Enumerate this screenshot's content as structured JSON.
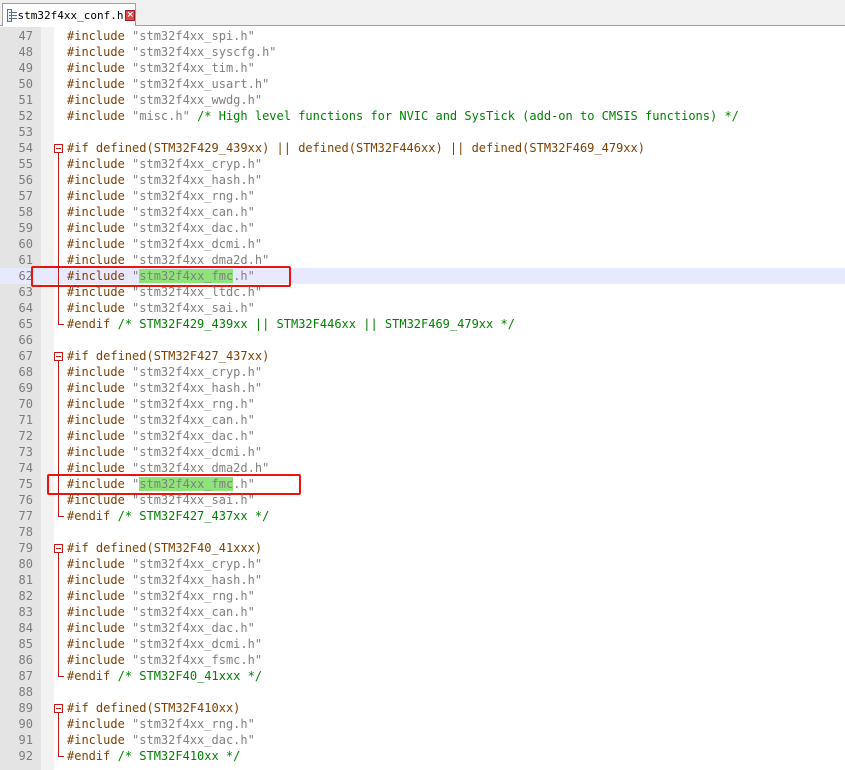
{
  "tab": {
    "label": "stm32f4xx_conf.h",
    "icon": "document-icon",
    "close_icon": "close-icon"
  },
  "colors": {
    "preprocessor": "#804000",
    "string": "#808080",
    "comment": "#008000",
    "find_highlight": "#8fe37a",
    "annotation": "#e8140e",
    "fold_marker": "#c01818",
    "current_line": "#e8e8ff"
  },
  "current_line": 62,
  "lines": [
    {
      "n": "47",
      "segments": [
        {
          "t": "#include ",
          "c": "pp"
        },
        {
          "t": "\"stm32f4xx_spi.h\"",
          "c": "str"
        }
      ]
    },
    {
      "n": "48",
      "segments": [
        {
          "t": "#include ",
          "c": "pp"
        },
        {
          "t": "\"stm32f4xx_syscfg.h\"",
          "c": "str"
        }
      ]
    },
    {
      "n": "49",
      "segments": [
        {
          "t": "#include ",
          "c": "pp"
        },
        {
          "t": "\"stm32f4xx_tim.h\"",
          "c": "str"
        }
      ]
    },
    {
      "n": "50",
      "segments": [
        {
          "t": "#include ",
          "c": "pp"
        },
        {
          "t": "\"stm32f4xx_usart.h\"",
          "c": "str"
        }
      ]
    },
    {
      "n": "51",
      "segments": [
        {
          "t": "#include ",
          "c": "pp"
        },
        {
          "t": "\"stm32f4xx_wwdg.h\"",
          "c": "str"
        }
      ]
    },
    {
      "n": "52",
      "segments": [
        {
          "t": "#include ",
          "c": "pp"
        },
        {
          "t": "\"misc.h\" ",
          "c": "str"
        },
        {
          "t": "/* High level functions for NVIC and SysTick (add-on to CMSIS functions) */",
          "c": "cmt"
        }
      ]
    },
    {
      "n": "53",
      "segments": []
    },
    {
      "n": "54",
      "fold": "open",
      "segments": [
        {
          "t": "#if defined(STM32F429_439xx) || defined(STM32F446xx) || defined(STM32F469_479xx)",
          "c": "pp"
        }
      ]
    },
    {
      "n": "55",
      "segments": [
        {
          "t": "#include ",
          "c": "pp"
        },
        {
          "t": "\"stm32f4xx_cryp.h\"",
          "c": "str"
        }
      ]
    },
    {
      "n": "56",
      "segments": [
        {
          "t": "#include ",
          "c": "pp"
        },
        {
          "t": "\"stm32f4xx_hash.h\"",
          "c": "str"
        }
      ]
    },
    {
      "n": "57",
      "segments": [
        {
          "t": "#include ",
          "c": "pp"
        },
        {
          "t": "\"stm32f4xx_rng.h\"",
          "c": "str"
        }
      ]
    },
    {
      "n": "58",
      "segments": [
        {
          "t": "#include ",
          "c": "pp"
        },
        {
          "t": "\"stm32f4xx_can.h\"",
          "c": "str"
        }
      ]
    },
    {
      "n": "59",
      "segments": [
        {
          "t": "#include ",
          "c": "pp"
        },
        {
          "t": "\"stm32f4xx_dac.h\"",
          "c": "str"
        }
      ]
    },
    {
      "n": "60",
      "segments": [
        {
          "t": "#include ",
          "c": "pp"
        },
        {
          "t": "\"stm32f4xx_dcmi.h\"",
          "c": "str"
        }
      ]
    },
    {
      "n": "61",
      "segments": [
        {
          "t": "#include ",
          "c": "pp"
        },
        {
          "t": "\"stm32f4xx_dma2d.h\"",
          "c": "str"
        }
      ]
    },
    {
      "n": "62",
      "annot": true,
      "segments": [
        {
          "t": "#include ",
          "c": "pp"
        },
        {
          "t": "\"",
          "c": "str"
        },
        {
          "t": "stm32f4xx_fmc",
          "c": "str",
          "hl": true
        },
        {
          "t": ".h\"",
          "c": "str"
        }
      ]
    },
    {
      "n": "63",
      "segments": [
        {
          "t": "#include ",
          "c": "pp"
        },
        {
          "t": "\"stm32f4xx_ltdc.h\"",
          "c": "str"
        }
      ]
    },
    {
      "n": "64",
      "segments": [
        {
          "t": "#include ",
          "c": "pp"
        },
        {
          "t": "\"stm32f4xx_sai.h\"",
          "c": "str"
        }
      ]
    },
    {
      "n": "65",
      "fold": "end",
      "segments": [
        {
          "t": "#endif ",
          "c": "pp"
        },
        {
          "t": "/* STM32F429_439xx || STM32F446xx || STM32F469_479xx */",
          "c": "cmt"
        }
      ]
    },
    {
      "n": "66",
      "segments": []
    },
    {
      "n": "67",
      "fold": "open",
      "segments": [
        {
          "t": "#if defined(STM32F427_437xx)",
          "c": "pp"
        }
      ]
    },
    {
      "n": "68",
      "segments": [
        {
          "t": "#include ",
          "c": "pp"
        },
        {
          "t": "\"stm32f4xx_cryp.h\"",
          "c": "str"
        }
      ]
    },
    {
      "n": "69",
      "segments": [
        {
          "t": "#include ",
          "c": "pp"
        },
        {
          "t": "\"stm32f4xx_hash.h\"",
          "c": "str"
        }
      ]
    },
    {
      "n": "70",
      "segments": [
        {
          "t": "#include ",
          "c": "pp"
        },
        {
          "t": "\"stm32f4xx_rng.h\"",
          "c": "str"
        }
      ]
    },
    {
      "n": "71",
      "segments": [
        {
          "t": "#include ",
          "c": "pp"
        },
        {
          "t": "\"stm32f4xx_can.h\"",
          "c": "str"
        }
      ]
    },
    {
      "n": "72",
      "segments": [
        {
          "t": "#include ",
          "c": "pp"
        },
        {
          "t": "\"stm32f4xx_dac.h\"",
          "c": "str"
        }
      ]
    },
    {
      "n": "73",
      "segments": [
        {
          "t": "#include ",
          "c": "pp"
        },
        {
          "t": "\"stm32f4xx_dcmi.h\"",
          "c": "str"
        }
      ]
    },
    {
      "n": "74",
      "segments": [
        {
          "t": "#include ",
          "c": "pp"
        },
        {
          "t": "\"stm32f4xx_dma2d.h\"",
          "c": "str"
        }
      ]
    },
    {
      "n": "75",
      "annot": true,
      "segments": [
        {
          "t": "#include ",
          "c": "pp"
        },
        {
          "t": "\"",
          "c": "str"
        },
        {
          "t": "stm32f4xx_fmc",
          "c": "str",
          "hl": true
        },
        {
          "t": ".h\"",
          "c": "str"
        }
      ]
    },
    {
      "n": "76",
      "segments": [
        {
          "t": "#include ",
          "c": "pp"
        },
        {
          "t": "\"stm32f4xx_sai.h\"",
          "c": "str"
        }
      ]
    },
    {
      "n": "77",
      "fold": "end",
      "segments": [
        {
          "t": "#endif ",
          "c": "pp"
        },
        {
          "t": "/* STM32F427_437xx */",
          "c": "cmt"
        }
      ]
    },
    {
      "n": "78",
      "segments": []
    },
    {
      "n": "79",
      "fold": "open",
      "segments": [
        {
          "t": "#if defined(STM32F40_41xxx)",
          "c": "pp"
        }
      ]
    },
    {
      "n": "80",
      "segments": [
        {
          "t": "#include ",
          "c": "pp"
        },
        {
          "t": "\"stm32f4xx_cryp.h\"",
          "c": "str"
        }
      ]
    },
    {
      "n": "81",
      "segments": [
        {
          "t": "#include ",
          "c": "pp"
        },
        {
          "t": "\"stm32f4xx_hash.h\"",
          "c": "str"
        }
      ]
    },
    {
      "n": "82",
      "segments": [
        {
          "t": "#include ",
          "c": "pp"
        },
        {
          "t": "\"stm32f4xx_rng.h\"",
          "c": "str"
        }
      ]
    },
    {
      "n": "83",
      "segments": [
        {
          "t": "#include ",
          "c": "pp"
        },
        {
          "t": "\"stm32f4xx_can.h\"",
          "c": "str"
        }
      ]
    },
    {
      "n": "84",
      "segments": [
        {
          "t": "#include ",
          "c": "pp"
        },
        {
          "t": "\"stm32f4xx_dac.h\"",
          "c": "str"
        }
      ]
    },
    {
      "n": "85",
      "segments": [
        {
          "t": "#include ",
          "c": "pp"
        },
        {
          "t": "\"stm32f4xx_dcmi.h\"",
          "c": "str"
        }
      ]
    },
    {
      "n": "86",
      "segments": [
        {
          "t": "#include ",
          "c": "pp"
        },
        {
          "t": "\"stm32f4xx_fsmc.h\"",
          "c": "str"
        }
      ]
    },
    {
      "n": "87",
      "fold": "end",
      "segments": [
        {
          "t": "#endif ",
          "c": "pp"
        },
        {
          "t": "/* STM32F40_41xxx */",
          "c": "cmt"
        }
      ]
    },
    {
      "n": "88",
      "segments": []
    },
    {
      "n": "89",
      "fold": "open",
      "segments": [
        {
          "t": "#if defined(STM32F410xx)",
          "c": "pp"
        }
      ]
    },
    {
      "n": "90",
      "segments": [
        {
          "t": "#include ",
          "c": "pp"
        },
        {
          "t": "\"stm32f4xx_rng.h\"",
          "c": "str"
        }
      ]
    },
    {
      "n": "91",
      "segments": [
        {
          "t": "#include ",
          "c": "pp"
        },
        {
          "t": "\"stm32f4xx_dac.h\"",
          "c": "str"
        }
      ]
    },
    {
      "n": "92",
      "fold": "end",
      "segments": [
        {
          "t": "#endif ",
          "c": "pp"
        },
        {
          "t": "/* STM32F410xx */",
          "c": "cmt"
        }
      ]
    }
  ]
}
